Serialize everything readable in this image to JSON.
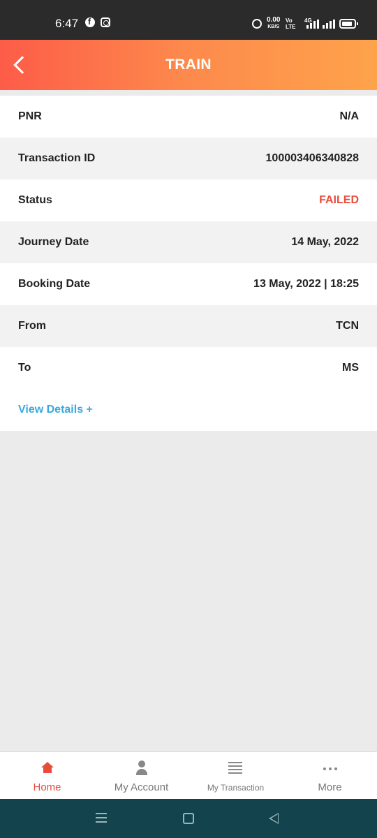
{
  "status_bar": {
    "time": "6:47",
    "speed_value": "0.00",
    "speed_unit": "KB/S",
    "volte_line1": "Vo",
    "volte_line2": "LTE",
    "network": "4G"
  },
  "header": {
    "title": "TRAIN",
    "gradient_start": "#fd5c48",
    "gradient_end": "#fea34b"
  },
  "details": [
    {
      "label": "PNR",
      "value": "N/A"
    },
    {
      "label": "Transaction ID",
      "value": "100003406340828"
    },
    {
      "label": "Status",
      "value": "FAILED"
    },
    {
      "label": "Journey Date",
      "value": "14 May, 2022"
    },
    {
      "label": "Booking Date",
      "value": "13 May, 2022 | 18:25"
    },
    {
      "label": "From",
      "value": "TCN"
    },
    {
      "label": "To",
      "value": "MS"
    }
  ],
  "view_details_label": "View Details +",
  "bottom_nav": [
    {
      "label": "Home",
      "icon": "home-icon",
      "active": true
    },
    {
      "label": "My Account",
      "icon": "user-icon",
      "active": false
    },
    {
      "label": "My Transaction",
      "icon": "list-icon",
      "active": false
    },
    {
      "label": "More",
      "icon": "more-dots-icon",
      "active": false
    }
  ],
  "colors": {
    "failed": "#e74c3c",
    "link": "#3aa8df",
    "active_nav": "#e74c3c",
    "system_nav_bg": "#13434d"
  }
}
